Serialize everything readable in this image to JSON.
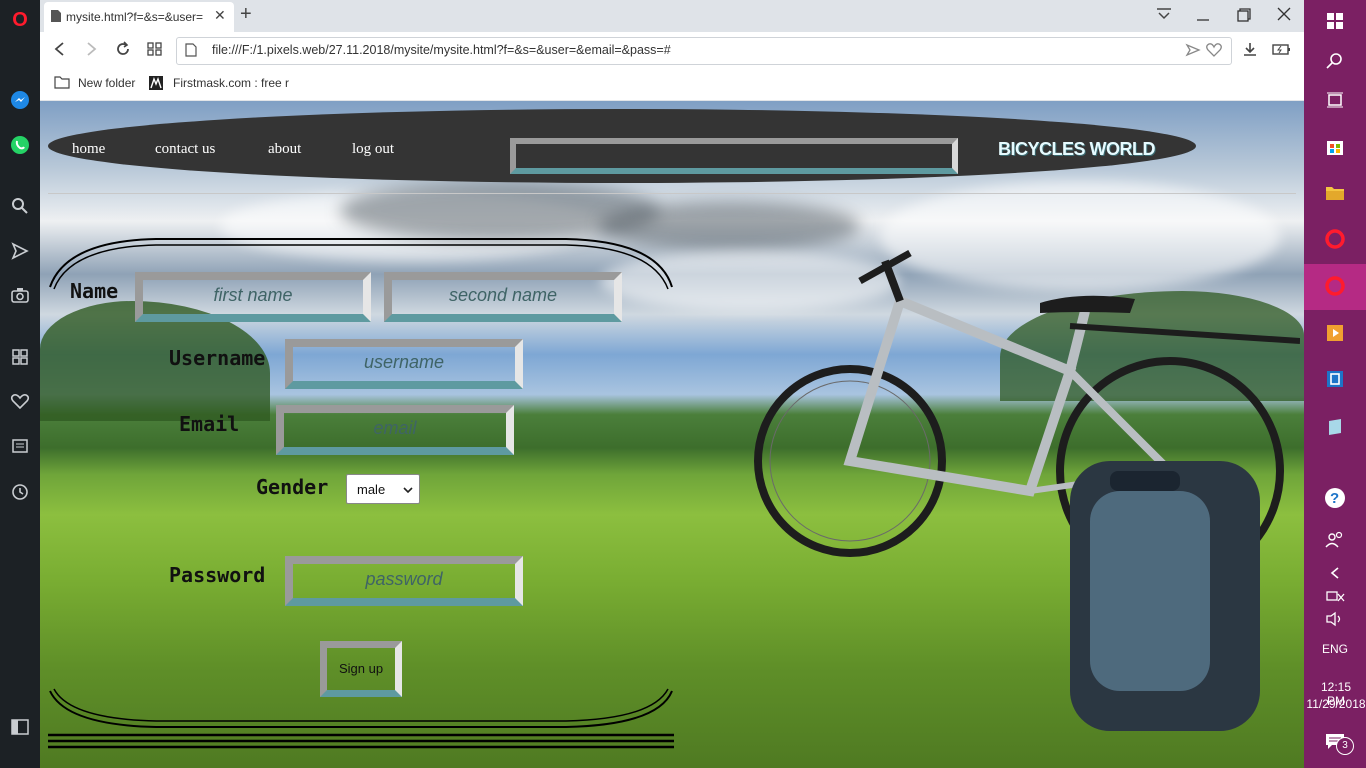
{
  "browser": {
    "tab_title": "mysite.html?f=&s=&user=",
    "new_tab_label": "+",
    "url": "file:///F:/1.pixels.web/27.11.2018/mysite/mysite.html?f=&s=&user=&email=&pass=#",
    "bookmarks": [
      "New folder",
      "Firstmask.com : free r"
    ]
  },
  "nav": {
    "links": [
      "home",
      "contact us",
      "about",
      "log out"
    ],
    "brand": "BICYCLES WORLD"
  },
  "form": {
    "name_label": "Name",
    "first_name_placeholder": "first name",
    "second_name_placeholder": "second name",
    "username_label": "Username",
    "username_placeholder": "username",
    "email_label": "Email",
    "email_placeholder": "email",
    "gender_label": "Gender",
    "gender_value": "male",
    "password_label": "Password",
    "password_placeholder": "password",
    "signup_label": "Sign up"
  },
  "taskbar": {
    "language": "ENG",
    "time": "12:15 PM",
    "date": "11/29/2018",
    "notifications": "3"
  }
}
